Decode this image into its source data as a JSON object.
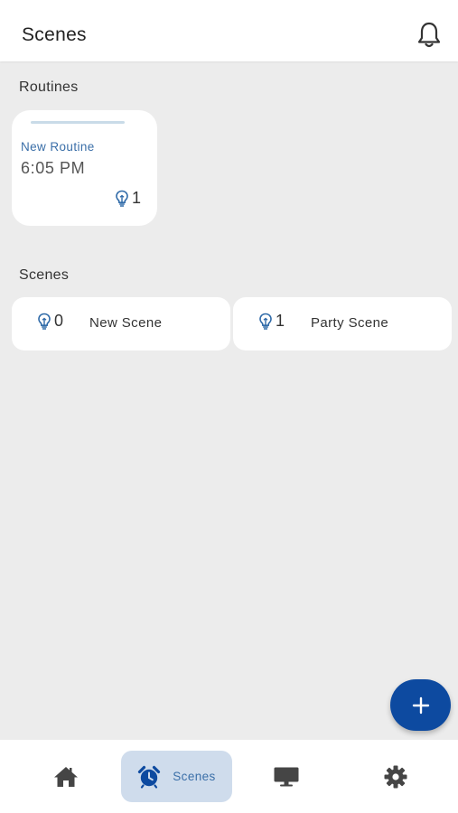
{
  "header": {
    "title": "Scenes"
  },
  "routines": {
    "heading": "Routines",
    "items": [
      {
        "name": "New Routine",
        "time": "6:05 PM",
        "light_count": "1"
      }
    ]
  },
  "scenes": {
    "heading": "Scenes",
    "items": [
      {
        "light_count": "0",
        "name": "New Scene"
      },
      {
        "light_count": "1",
        "name": "Party Scene"
      }
    ]
  },
  "fab": {
    "icon": "plus-icon"
  },
  "bottom_nav": {
    "items": [
      {
        "icon": "home-icon",
        "label": ""
      },
      {
        "icon": "alarm-clock-icon",
        "label": "Scenes",
        "active": true
      },
      {
        "icon": "monitor-icon",
        "label": ""
      },
      {
        "icon": "gear-icon",
        "label": ""
      }
    ]
  },
  "colors": {
    "accent": "#0d4aa0",
    "accent_text": "#3b6fa8",
    "active_nav_bg": "#cfdcec",
    "background": "#ececec",
    "card": "#ffffff"
  }
}
